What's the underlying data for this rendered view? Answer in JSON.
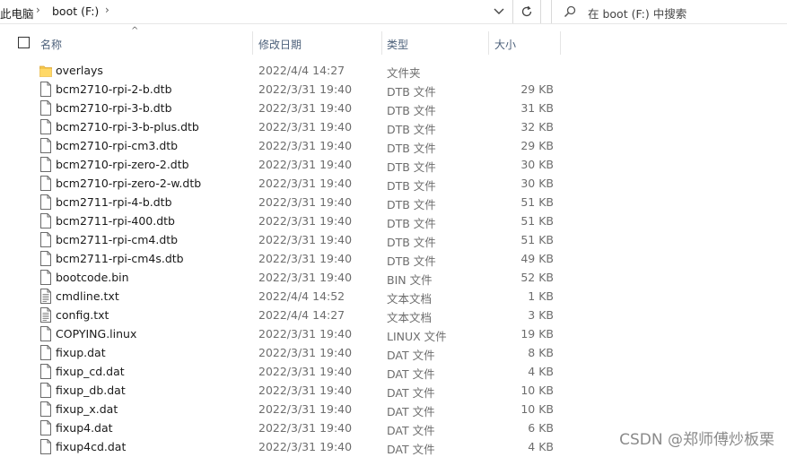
{
  "address": {
    "this_pc": "此电脑",
    "drive": "boot (F:)",
    "search_placeholder": "在 boot (F:) 中搜索"
  },
  "columns": {
    "name": "名称",
    "date": "修改日期",
    "type": "类型",
    "size": "大小"
  },
  "files": [
    {
      "name": "overlays",
      "date": "2022/4/4 14:27",
      "type": "文件夹",
      "size": "",
      "icon": "folder-icon"
    },
    {
      "name": "bcm2710-rpi-2-b.dtb",
      "date": "2022/3/31 19:40",
      "type": "DTB 文件",
      "size": "29 KB",
      "icon": "file-icon"
    },
    {
      "name": "bcm2710-rpi-3-b.dtb",
      "date": "2022/3/31 19:40",
      "type": "DTB 文件",
      "size": "31 KB",
      "icon": "file-icon"
    },
    {
      "name": "bcm2710-rpi-3-b-plus.dtb",
      "date": "2022/3/31 19:40",
      "type": "DTB 文件",
      "size": "32 KB",
      "icon": "file-icon"
    },
    {
      "name": "bcm2710-rpi-cm3.dtb",
      "date": "2022/3/31 19:40",
      "type": "DTB 文件",
      "size": "29 KB",
      "icon": "file-icon"
    },
    {
      "name": "bcm2710-rpi-zero-2.dtb",
      "date": "2022/3/31 19:40",
      "type": "DTB 文件",
      "size": "30 KB",
      "icon": "file-icon"
    },
    {
      "name": "bcm2710-rpi-zero-2-w.dtb",
      "date": "2022/3/31 19:40",
      "type": "DTB 文件",
      "size": "30 KB",
      "icon": "file-icon"
    },
    {
      "name": "bcm2711-rpi-4-b.dtb",
      "date": "2022/3/31 19:40",
      "type": "DTB 文件",
      "size": "51 KB",
      "icon": "file-icon"
    },
    {
      "name": "bcm2711-rpi-400.dtb",
      "date": "2022/3/31 19:40",
      "type": "DTB 文件",
      "size": "51 KB",
      "icon": "file-icon"
    },
    {
      "name": "bcm2711-rpi-cm4.dtb",
      "date": "2022/3/31 19:40",
      "type": "DTB 文件",
      "size": "51 KB",
      "icon": "file-icon"
    },
    {
      "name": "bcm2711-rpi-cm4s.dtb",
      "date": "2022/3/31 19:40",
      "type": "DTB 文件",
      "size": "49 KB",
      "icon": "file-icon"
    },
    {
      "name": "bootcode.bin",
      "date": "2022/3/31 19:40",
      "type": "BIN 文件",
      "size": "52 KB",
      "icon": "file-icon"
    },
    {
      "name": "cmdline.txt",
      "date": "2022/4/4 14:52",
      "type": "文本文档",
      "size": "1 KB",
      "icon": "text-file-icon"
    },
    {
      "name": "config.txt",
      "date": "2022/4/4 14:27",
      "type": "文本文档",
      "size": "3 KB",
      "icon": "text-file-icon"
    },
    {
      "name": "COPYING.linux",
      "date": "2022/3/31 19:40",
      "type": "LINUX 文件",
      "size": "19 KB",
      "icon": "file-icon"
    },
    {
      "name": "fixup.dat",
      "date": "2022/3/31 19:40",
      "type": "DAT 文件",
      "size": "8 KB",
      "icon": "file-icon"
    },
    {
      "name": "fixup_cd.dat",
      "date": "2022/3/31 19:40",
      "type": "DAT 文件",
      "size": "4 KB",
      "icon": "file-icon"
    },
    {
      "name": "fixup_db.dat",
      "date": "2022/3/31 19:40",
      "type": "DAT 文件",
      "size": "10 KB",
      "icon": "file-icon"
    },
    {
      "name": "fixup_x.dat",
      "date": "2022/3/31 19:40",
      "type": "DAT 文件",
      "size": "10 KB",
      "icon": "file-icon"
    },
    {
      "name": "fixup4.dat",
      "date": "2022/3/31 19:40",
      "type": "DAT 文件",
      "size": "6 KB",
      "icon": "file-icon"
    },
    {
      "name": "fixup4cd.dat",
      "date": "2022/3/31 19:40",
      "type": "DAT 文件",
      "size": "4 KB",
      "icon": "file-icon"
    }
  ],
  "watermark": "CSDN @郑师傅炒板栗"
}
